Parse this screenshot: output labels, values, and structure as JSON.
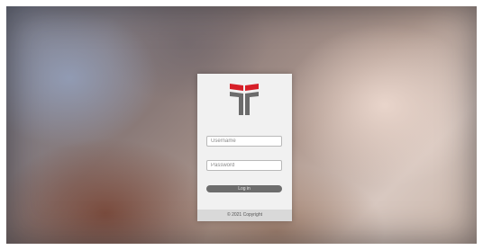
{
  "login": {
    "username_placeholder": "Username",
    "password_placeholder": "Password",
    "login_label": "Log in",
    "footer_text": "© 2021 Copyright"
  },
  "colors": {
    "logo_red": "#d71f28",
    "logo_gray": "#6b6b6b",
    "button": "#6d6d6d",
    "card": "#f1f1f1"
  },
  "icons": {
    "logo": "institution-logo-icon"
  }
}
